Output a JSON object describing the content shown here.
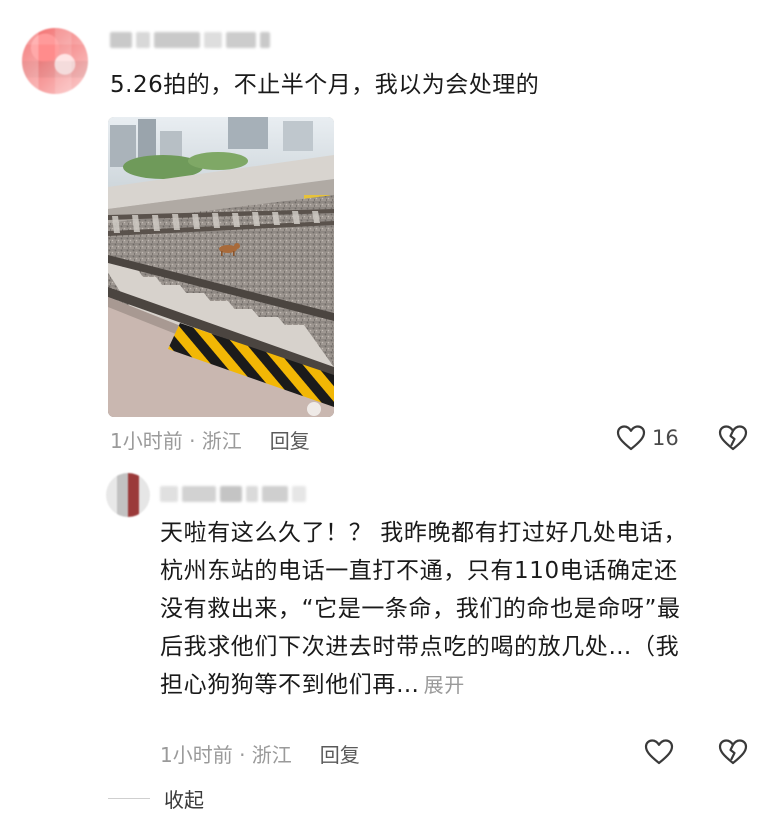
{
  "top_comment": {
    "text": "5.26拍的，不止半个月，我以为会处理的",
    "time_location": "1小时前 · 浙江",
    "reply_label": "回复",
    "like_count": "16",
    "icons": {
      "like": "heart-icon",
      "dislike": "broken-heart-icon"
    }
  },
  "reply_comment": {
    "lines": [
      "天啦有这么久了！？ 我昨晚都有打过好几处电话，",
      "杭州东站的电话一直打不通，只有110电话确定还",
      "没有救出来，“它是一条命，我们的命也是命呀”最",
      "后我求他们下次进去时带点吃的喝的放几处…（我",
      "担心狗狗等不到他们再…"
    ],
    "expand_label": "展开",
    "time_location": "1小时前 · 浙江",
    "reply_label": "回复",
    "icons": {
      "like": "heart-icon",
      "dislike": "broken-heart-icon"
    }
  },
  "collapse_label": "收起",
  "colors": {
    "text": "#1a1a1a",
    "meta": "#9a9a9a",
    "hazard_yellow": "#f2b705",
    "hazard_black": "#1b1b1b"
  }
}
